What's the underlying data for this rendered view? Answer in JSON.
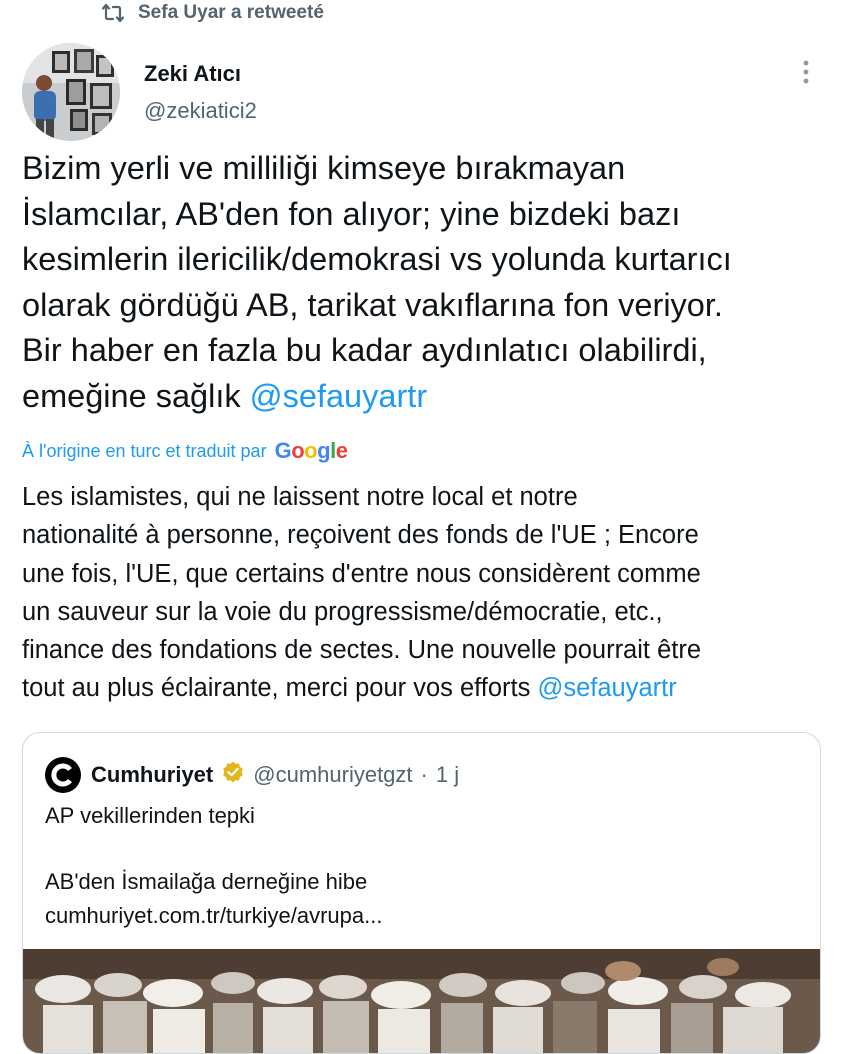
{
  "retweet_banner": {
    "icon": "retweet-icon",
    "text": "Sefa Uyar a retweeté"
  },
  "tweet": {
    "author_name": "Zeki Atıcı",
    "author_handle": "@zekiatici2",
    "avatar": "avatar-photo",
    "more_icon": "more-vertical-icon",
    "text_body": "Bizim yerli ve milliliği kimseye bırakmayan\nİslamcılar, AB'den fon alıyor; yine bizdeki bazı\nkesimlerin ilericilik/demokrasi vs yolunda kurtarıcı\nolarak gördüğü AB, tarikat vakıflarına fon veriyor.\nBir haber en fazla bu kadar aydınlatıcı olabilirdi,\nemeğine sağlık ",
    "text_mention": "@sefauyartr",
    "translation_label": "À l'origine en turc et traduit par",
    "translation_provider": "Google",
    "translated_body": "Les islamistes, qui ne laissent notre local et notre\nnationalité à personne, reçoivent des fonds de l'UE ; Encore\nune fois, l'UE, que certains d'entre nous considèrent comme\nun sauveur sur la voie du progressisme/démocratie, etc.,\nfinance des fondations de sectes. Une nouvelle pourrait être\ntout au plus éclairante, merci pour vos efforts ",
    "translated_mention": "@sefauyartr"
  },
  "quote": {
    "avatar_letter": "C",
    "name": "Cumhuriyet",
    "verified_icon": "verified-badge-icon",
    "handle": "@cumhuriyetgzt",
    "separator": "·",
    "time": "1 j",
    "line1": "AP vekillerinden tepki",
    "line2": "AB'den İsmailağa derneğine hibe",
    "link": "cumhuriyet.com.tr/turkiye/avrupa..."
  },
  "colors": {
    "accent": "#1d9bf0",
    "secondary_text": "#536471",
    "primary_text": "#0f1419",
    "verified_gold": "#e2b719"
  }
}
